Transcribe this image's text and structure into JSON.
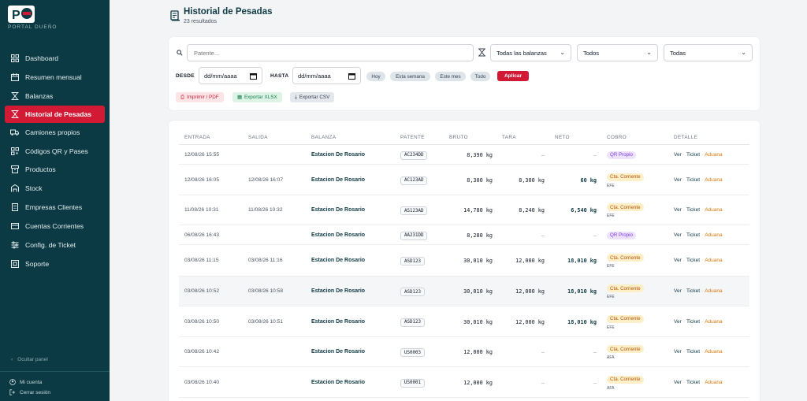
{
  "brand": {
    "logo_text": "P",
    "name": "PORTAL DUEÑO"
  },
  "sidebar": {
    "items": [
      {
        "label": "Dashboard",
        "icon": "dashboard-icon"
      },
      {
        "label": "Resumen mensual",
        "icon": "calendar-icon"
      },
      {
        "label": "Balanzas",
        "icon": "scale-icon"
      },
      {
        "label": "Historial de Pesadas",
        "icon": "history-icon",
        "active": true
      },
      {
        "label": "Camiones propios",
        "icon": "truck-icon"
      },
      {
        "label": "Códigos QR y Pases",
        "icon": "qr-icon"
      },
      {
        "label": "Productos",
        "icon": "box-icon"
      },
      {
        "label": "Stock",
        "icon": "warehouse-icon"
      },
      {
        "label": "Empresas Clientes",
        "icon": "building-icon"
      },
      {
        "label": "Cuentas Corrientes",
        "icon": "wallet-icon"
      },
      {
        "label": "Config. de Ticket",
        "icon": "sliders-icon"
      },
      {
        "label": "Soporte",
        "icon": "support-icon"
      }
    ],
    "hide_panel": "Ocultar panel",
    "my_account": "Mi cuenta",
    "logout": "Cerrar sesión"
  },
  "header": {
    "title": "Historial de Pesadas",
    "subtitle": "23 resultados"
  },
  "filters": {
    "search_placeholder": "Patente...",
    "balanza_select": "Todas las balanzas",
    "select2": "Todos",
    "select3": "Todas",
    "desde_label": "DESDE",
    "hasta_label": "HASTA",
    "date_placeholder": "dd/mm/aaaa",
    "chips": [
      "Hoy",
      "Esta semana",
      "Este mes",
      "Todo"
    ],
    "apply": "Aplicar",
    "export_pdf": "Imprimir / PDF",
    "export_xlsx": "Exportar XLSX",
    "export_csv": "Exportar CSV"
  },
  "table": {
    "columns": [
      "ENTRADA",
      "SALIDA",
      "BALANZA",
      "PATENTE",
      "BRUTO",
      "TARA",
      "NETO",
      "COBRO",
      "DETALLE"
    ],
    "detail_links": {
      "ver": "Ver",
      "ticket": "Ticket",
      "aduana": "Aduana",
      "sep": "·"
    },
    "rows": [
      {
        "entrada": "12/08/26 15:55",
        "salida": "",
        "balanza": "Estacion De Rosario",
        "patente": "AC234DD",
        "bruto": "8,390 kg",
        "tara": "—",
        "neto": "—",
        "cobro": "QR Propio",
        "cobro_type": "qr",
        "cobro_sub": ""
      },
      {
        "entrada": "12/08/26 16:05",
        "salida": "12/08/26 16:07",
        "balanza": "Estacion De Rosario",
        "patente": "AC123AD",
        "bruto": "8,300 kg",
        "tara": "8,300 kg",
        "neto": "60 kg",
        "cobro": "Cta. Corriente",
        "cobro_type": "cta",
        "cobro_sub": "EFE"
      },
      {
        "entrada": "11/08/26 10:31",
        "salida": "11/08/26 10:32",
        "balanza": "Estacion De Rosario",
        "patente": "AS123AD",
        "bruto": "14,780 kg",
        "tara": "8,240 kg",
        "neto": "6,540 kg",
        "cobro": "Cta. Corriente",
        "cobro_type": "cta",
        "cobro_sub": "EFE"
      },
      {
        "entrada": "06/08/26 16:43",
        "salida": "",
        "balanza": "Estacion De Rosario",
        "patente": "AA231DD",
        "bruto": "8,280 kg",
        "tara": "—",
        "neto": "—",
        "cobro": "QR Propio",
        "cobro_type": "qr",
        "cobro_sub": ""
      },
      {
        "entrada": "03/08/26 11:15",
        "salida": "03/08/26 11:16",
        "balanza": "Estacion De Rosario",
        "patente": "ASD123",
        "bruto": "30,010 kg",
        "tara": "12,000 kg",
        "neto": "18,010 kg",
        "cobro": "Cta. Corriente",
        "cobro_type": "cta",
        "cobro_sub": "EFE"
      },
      {
        "entrada": "03/08/26 10:52",
        "salida": "03/08/26 10:58",
        "balanza": "Estacion De Rosario",
        "patente": "ASD123",
        "bruto": "30,010 kg",
        "tara": "12,000 kg",
        "neto": "18,010 kg",
        "cobro": "Cta. Corriente",
        "cobro_type": "cta",
        "cobro_sub": "EFE"
      },
      {
        "entrada": "03/08/26 10:50",
        "salida": "03/08/26 10:51",
        "balanza": "Estacion De Rosario",
        "patente": "ASD123",
        "bruto": "30,010 kg",
        "tara": "12,000 kg",
        "neto": "18,010 kg",
        "cobro": "Cta. Corriente",
        "cobro_type": "cta",
        "cobro_sub": "EFE"
      },
      {
        "entrada": "03/08/26 10:42",
        "salida": "",
        "balanza": "Estacion De Rosario",
        "patente": "US0003",
        "bruto": "12,000 kg",
        "tara": "—",
        "neto": "—",
        "cobro": "Cta. Corriente",
        "cobro_type": "cta",
        "cobro_sub": "AFA"
      },
      {
        "entrada": "03/08/26 10:40",
        "salida": "",
        "balanza": "Estacion De Rosario",
        "patente": "US0001",
        "bruto": "12,000 kg",
        "tara": "—",
        "neto": "—",
        "cobro": "Cta. Corriente",
        "cobro_type": "cta",
        "cobro_sub": "AFA"
      }
    ]
  },
  "colors": {
    "sidebar_bg": "#0b3a44",
    "accent": "#d31a35",
    "title": "#0f3a45"
  }
}
